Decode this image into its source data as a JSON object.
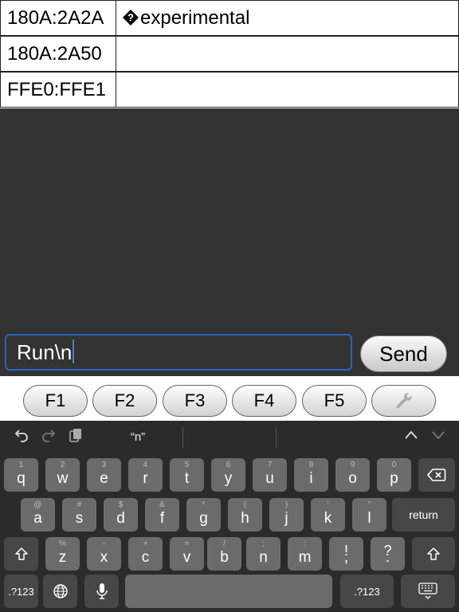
{
  "characteristics": [
    {
      "uuid": "180A:2A2A",
      "description": "experimental",
      "has_icon": true
    },
    {
      "uuid": "180A:2A50",
      "description": "",
      "has_icon": false
    },
    {
      "uuid": "FFE0:FFE1",
      "description": "",
      "has_icon": false
    }
  ],
  "terminal": {
    "input_value": "Run\\n",
    "send_label": "Send"
  },
  "function_keys": [
    "F1",
    "F2",
    "F3",
    "F4",
    "F5"
  ],
  "settings_icon": "wrench-icon",
  "keyboard": {
    "suggestion": "“n”",
    "row1": [
      [
        "1",
        "q"
      ],
      [
        "2",
        "w"
      ],
      [
        "3",
        "e"
      ],
      [
        "4",
        "r"
      ],
      [
        "5",
        "t"
      ],
      [
        "6",
        "y"
      ],
      [
        "7",
        "u"
      ],
      [
        "8",
        "i"
      ],
      [
        "9",
        "o"
      ],
      [
        "0",
        "p"
      ]
    ],
    "row2": [
      [
        "@",
        "a"
      ],
      [
        "#",
        "s"
      ],
      [
        "$",
        "d"
      ],
      [
        "&",
        "f"
      ],
      [
        "*",
        "g"
      ],
      [
        "(",
        "h"
      ],
      [
        ")",
        "j"
      ],
      [
        "'",
        "k"
      ],
      [
        "\"",
        "l"
      ]
    ],
    "row3": [
      [
        "%",
        "z"
      ],
      [
        "-",
        "x"
      ],
      [
        "+",
        "c"
      ],
      [
        "=",
        "v"
      ],
      [
        "/",
        "b"
      ],
      [
        ";",
        "n"
      ],
      [
        ":",
        "m"
      ],
      [
        "!",
        ","
      ],
      [
        "?",
        "."
      ]
    ],
    "return_label": "return",
    "numbers_label": ".?123"
  },
  "colors": {
    "terminal_bg": "#333333",
    "input_border": "#2a66c8",
    "keyboard_bg": "#2b2b2b",
    "key_bg": "#6b6b6b",
    "special_key_bg": "#474747"
  }
}
